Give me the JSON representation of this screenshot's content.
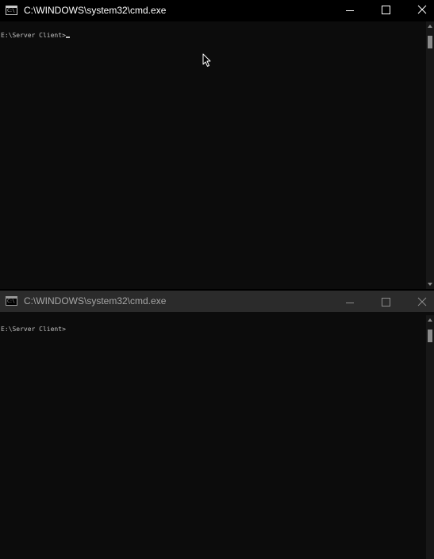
{
  "windows": [
    {
      "id": "top",
      "state": "active",
      "title": "C:\\WINDOWS\\system32\\cmd.exe",
      "icon": "console-app-icon",
      "icon_glyph": "C:\\",
      "controls": {
        "minimize": "minimize-icon",
        "maximize": "maximize-icon",
        "close": "close-icon"
      },
      "console": {
        "prompt": "E:\\Server Client>",
        "cursor_visible": true
      }
    },
    {
      "id": "bottom",
      "state": "inactive",
      "title": "C:\\WINDOWS\\system32\\cmd.exe",
      "icon": "console-app-icon",
      "icon_glyph": "C:\\",
      "controls": {
        "minimize": "minimize-icon",
        "maximize": "maximize-icon",
        "close": "close-icon"
      },
      "console": {
        "prompt": "E:\\Server Client>",
        "cursor_visible": false
      }
    }
  ],
  "colors": {
    "console_background": "#0c0c0c",
    "console_text": "#c0c0c0",
    "active_titlebar": "#000000",
    "inactive_titlebar": "#2b2b2b",
    "scrollbar_thumb": "#8a8a8a"
  },
  "mouse_pointer": "arrow-cursor-icon"
}
